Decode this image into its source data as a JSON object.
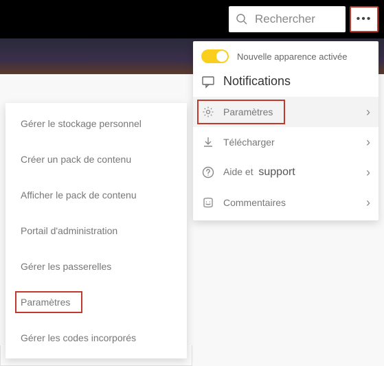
{
  "topbar": {
    "search_placeholder": "Rechercher"
  },
  "dropdown": {
    "toggle_label": "Nouvelle apparence activée",
    "notifications_label": "Notifications",
    "items": [
      {
        "label": "Paramètres"
      },
      {
        "label": "Télécharger"
      },
      {
        "label_part1": "Aide et",
        "label_part2": "support"
      },
      {
        "label": "Commentaires"
      }
    ]
  },
  "submenu": {
    "items": [
      "Gérer le stockage personnel",
      "Créer un pack de contenu",
      "Afficher le pack de contenu",
      "Portail d'administration",
      "Gérer les passerelles",
      "Paramètres",
      "Gérer les codes incorporés"
    ]
  }
}
